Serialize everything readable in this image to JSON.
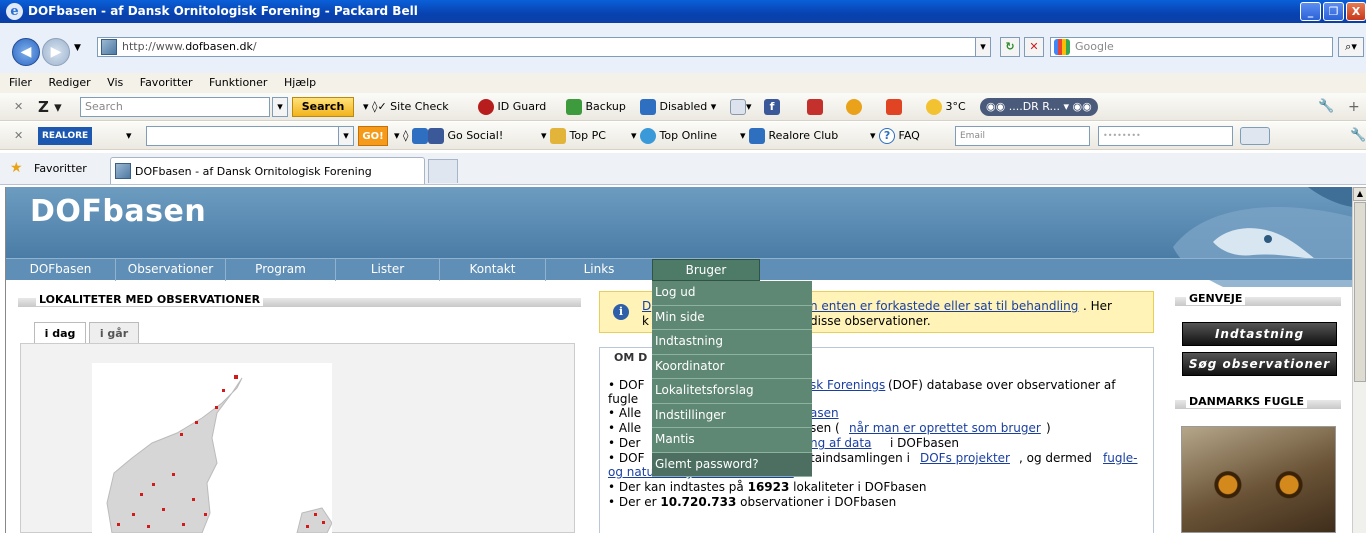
{
  "window": {
    "title": "DOFbasen - af Dansk Ornitologisk Forening - Packard Bell",
    "min": "_",
    "max": "❐",
    "close": "X"
  },
  "address": {
    "prefix": "http://www.",
    "host": "dofbasen.dk",
    "suffix": "/",
    "search_placeholder": "Google"
  },
  "menubar": [
    "Filer",
    "Rediger",
    "Vis",
    "Favoritter",
    "Funktioner",
    "Hjælp"
  ],
  "toolbar1": {
    "search_placeholder": "Search",
    "search_btn": "Search",
    "site_check": "Site Check",
    "id_guard": "ID Guard",
    "backup": "Backup",
    "disabled": "Disabled",
    "weather": "3°C",
    "radio": "....DR R..."
  },
  "toolbar2": {
    "go": "GO!",
    "go_social": "Go Social!",
    "top_pc": "Top PC",
    "top_online": "Top Online",
    "realore_club": "Realore Club",
    "faq": "FAQ",
    "email_placeholder": "Email",
    "password_mask": "••••••••"
  },
  "favorites": {
    "label": "Favoritter",
    "tab_title": "DOFbasen - af Dansk Ornitologisk Forening"
  },
  "site": {
    "logo": "DOFbasen",
    "nav": [
      "DOFbasen",
      "Observationer",
      "Program",
      "Lister",
      "Kontakt",
      "Links",
      "Bruger"
    ],
    "left_heading": "LOKALITETER MED OBSERVATIONER",
    "tabs": [
      "i dag",
      "i går"
    ],
    "notice": {
      "icon": "i",
      "line1_start": "D",
      "link": "n enten er forkastede eller sat til behandling",
      "line1_end": ". Her",
      "line2_start": "k",
      "line2_end": "disse observationer."
    },
    "omd_heading": "OM D",
    "bullets": {
      "b1a": "• DOF",
      "b1b": "sk Forenings",
      "b1c": " (DOF) database over observationer af",
      "b1d": "fugle",
      "b2a": "• Alle",
      "b2b": "asen",
      "b3a": "• Alle",
      "b3b": "sen (",
      "b3c": "når man er oprettet som bruger",
      "b3d": ")",
      "b4a": "• Der",
      "b4b": "ng af data",
      "b4c": " i DOFbasen",
      "b5a": "• DOF",
      "b5b": "taindsamlingen i ",
      "b5c": "DOFs projekter",
      "b5d": ", og dermed ",
      "b5e": "fugle-",
      "b5f": "og naturbeskyttelse i Danmark",
      "b6a": "• Der kan indtastes på ",
      "b6b": "16923",
      "b6c": " lokaliteter i DOFbasen",
      "b7a": "• Der er ",
      "b7b": "10.720.733",
      "b7c": " observationer i DOFbasen"
    },
    "right": {
      "genveje": "GENVEJE",
      "btn_indtast": "Indtastning",
      "btn_sog": "Søg observationer",
      "danmarks_fugle": "DANMARKS FUGLE"
    },
    "dropdown": [
      "Log ud",
      "Min side",
      "Indtastning",
      "Koordinator",
      "Lokalitetsforslag",
      "Indstillinger",
      "Mantis",
      "Glemt password?"
    ]
  }
}
